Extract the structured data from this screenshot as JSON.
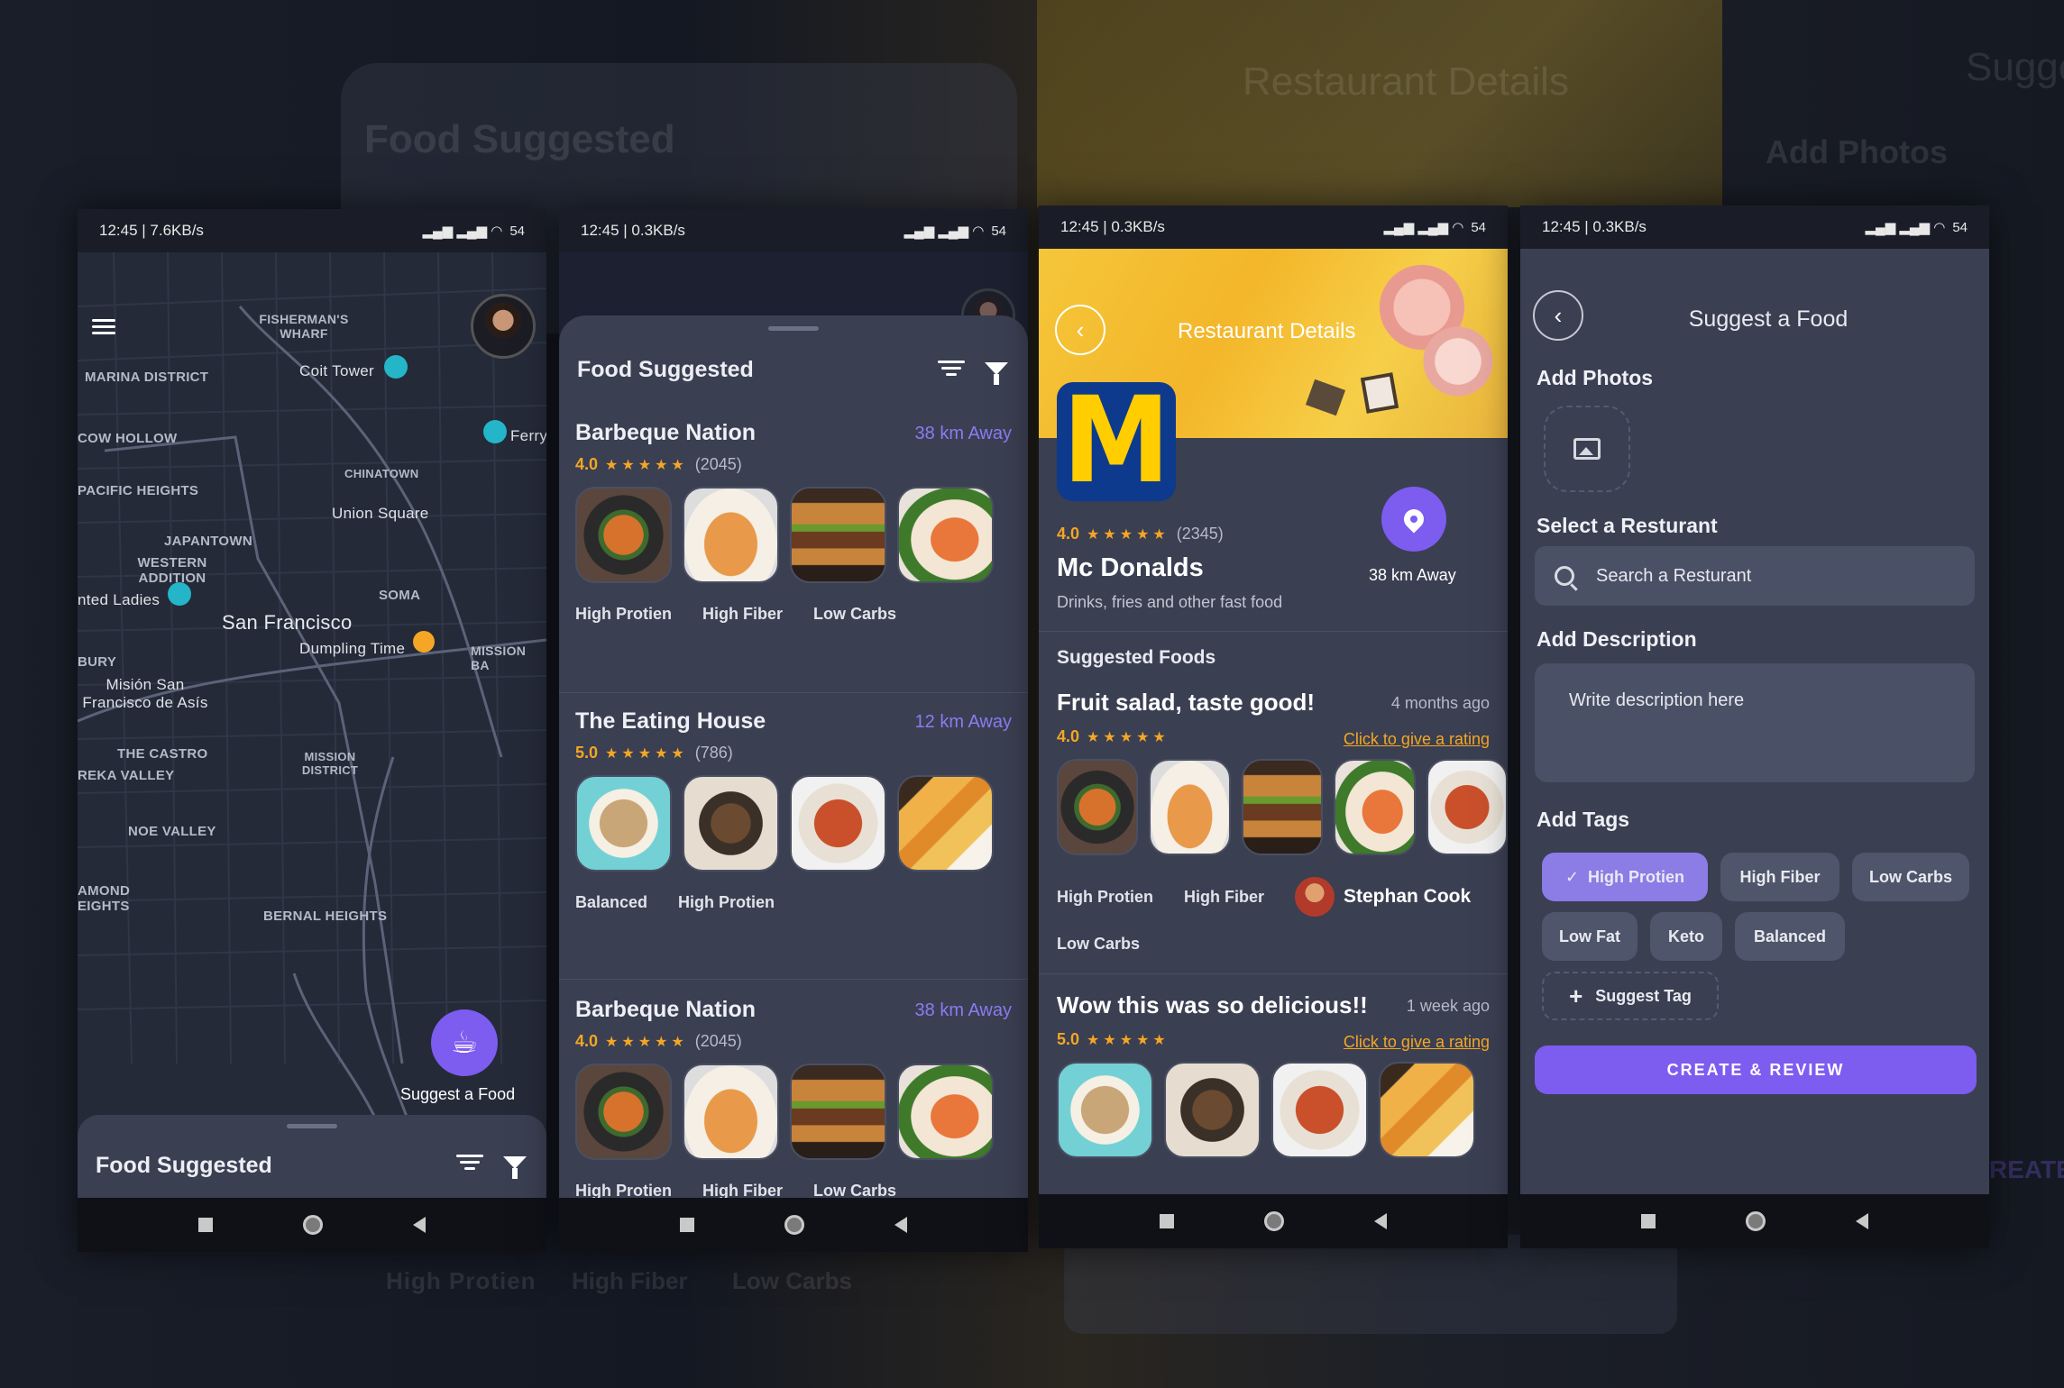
{
  "status": {
    "p1": "12:45 | 7.6KB/s",
    "p2": "12:45 | 0.3KB/s",
    "p3": "12:45 | 0.3KB/s",
    "p4": "12:45 | 0.3KB/s",
    "battery": "54"
  },
  "background": {
    "title_left": "Food Suggested",
    "title_right_1": "Restaurant Details",
    "title_right_2": "Sugge",
    "add_photos": "Add Photos",
    "tag1": "High Protien",
    "tag2": "High Fiber",
    "tag3": "Low Carbs",
    "create": "REATE"
  },
  "map": {
    "labels": [
      "FISHERMAN'S WHARF",
      "MARINA DISTRICT",
      "Coit Tower",
      "COW HOLLOW",
      "Ferry",
      "CHINATOWN",
      "PACIFIC HEIGHTS",
      "Union Square",
      "JAPANTOWN",
      "WESTERN ADDITION",
      "SOMA",
      "nted Ladies",
      "San Francisco",
      "Dumpling Time",
      "MISSION BA",
      "Misión San Francisco de Asís",
      "THE CASTRO",
      "MISSION DISTRICT",
      "REKA VALLEY",
      "NOE VALLEY",
      "BERNAL HEIGHTS",
      "AMOND EIGHTS",
      "BURY"
    ],
    "fab_label": "Suggest a Food",
    "sheet_title": "Food Suggested"
  },
  "list": {
    "title": "Food Suggested",
    "restaurants": [
      {
        "name": "Barbeque Nation",
        "distance": "38 km Away",
        "rating": "4.0",
        "stars": "★★★★★",
        "count": "(2045)",
        "tags": [
          "High Protien",
          "High Fiber",
          "Low Carbs"
        ]
      },
      {
        "name": "The Eating House",
        "distance": "12 km Away",
        "rating": "5.0",
        "stars": "★★★★★",
        "count": "(786)",
        "tags": [
          "Balanced",
          "High Protien"
        ]
      },
      {
        "name": "Barbeque Nation",
        "distance": "38 km Away",
        "rating": "4.0",
        "stars": "★★★★★",
        "count": "(2045)",
        "tags": [
          "High Protien",
          "High Fiber",
          "Low Carbs"
        ]
      }
    ]
  },
  "details": {
    "header": "Restaurant Details",
    "rating": "4.0",
    "stars": "★★★★★",
    "count": "(2345)",
    "name": "Mc Donalds",
    "subtitle": "Drinks, fries and other fast food",
    "distance": "38 km Away",
    "section": "Suggested Foods",
    "reviews": [
      {
        "title": "Fruit salad, taste good!",
        "time": "4 months ago",
        "rating": "4.0",
        "stars": "★★★★★",
        "link": "Click to give a rating",
        "tags": [
          "High Protien",
          "High Fiber",
          "Low Carbs"
        ],
        "author": "Stephan Cook"
      },
      {
        "title": "Wow this was so delicious!!",
        "time": "1 week ago",
        "rating": "5.0",
        "stars": "★★★★★",
        "link": "Click to give a rating"
      }
    ]
  },
  "suggest": {
    "title": "Suggest a Food",
    "add_photos": "Add Photos",
    "select_restaurant": "Select a Resturant",
    "search_placeholder": "Search a Resturant",
    "add_description": "Add Description",
    "description_placeholder": "Write description here",
    "add_tags": "Add Tags",
    "tags": [
      "High Protien",
      "High Fiber",
      "Low Carbs",
      "Low Fat",
      "Keto",
      "Balanced"
    ],
    "selected_tag": "High Protien",
    "suggest_tag": "Suggest Tag",
    "cta": "CREATE & REVIEW"
  },
  "colors": {
    "accent": "#7d5cf0",
    "star": "#f4a624",
    "card": "#3a3f52",
    "distance": "#8a7cf2"
  }
}
